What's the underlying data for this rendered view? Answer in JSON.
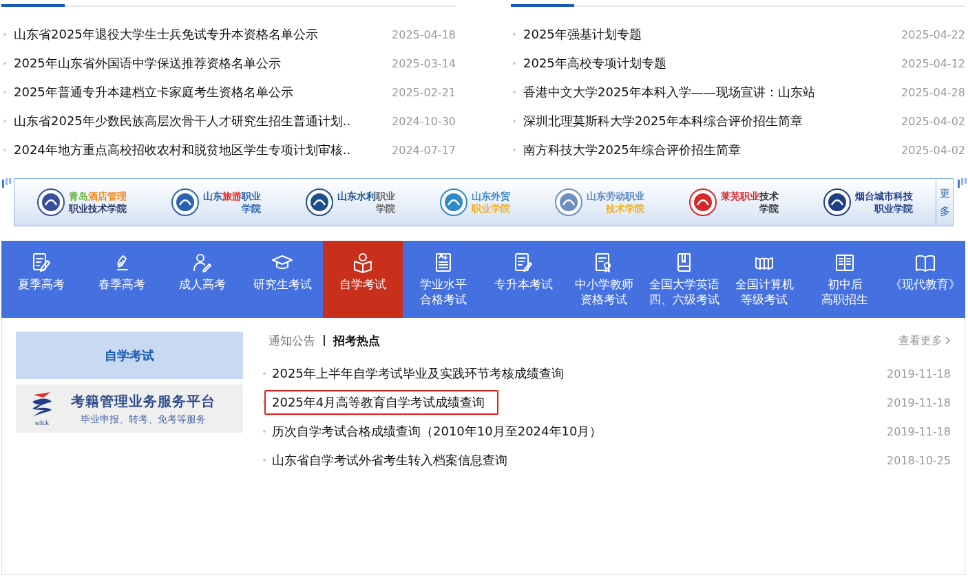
{
  "news_columns": [
    {
      "items": [
        {
          "title": "山东省2025年退役大学生士兵免试专升本资格名单公示",
          "date": "2025-04-18"
        },
        {
          "title": "2025年山东省外国语中学保送推荐资格名单公示",
          "date": "2025-03-14"
        },
        {
          "title": "2025年普通专升本建档立卡家庭考生资格名单公示",
          "date": "2025-02-21"
        },
        {
          "title": "山东省2025年少数民族高层次骨干人才研究生招生普通计划..",
          "date": "2024-10-30"
        },
        {
          "title": "2024年地方重点高校招收农村和脱贫地区学生专项计划审核..",
          "date": "2024-07-17"
        }
      ]
    },
    {
      "items": [
        {
          "title": "2025年强基计划专题",
          "date": "2025-04-22"
        },
        {
          "title": "2025年高校专项计划专题",
          "date": "2025-04-12"
        },
        {
          "title": "香港中文大学2025年本科入学——现场宣讲：山东站",
          "date": "2025-04-28"
        },
        {
          "title": "深圳北理莫斯科大学2025年本科综合评价招生简章",
          "date": "2025-04-02"
        },
        {
          "title": "南方科技大学2025年综合评价招生简章",
          "date": "2025-04-02"
        }
      ]
    }
  ],
  "school_logos": {
    "more": "更多",
    "items": [
      {
        "color": "#3a4f9c",
        "lines": [
          [
            {
              "text": "青岛",
              "color": "#6cb33e"
            },
            {
              "text": "酒店管理",
              "color": "#f08a1c"
            }
          ],
          [
            {
              "text": "职业技术学院",
              "color": "#2a3560"
            }
          ]
        ]
      },
      {
        "color": "#2a63ad",
        "lines": [
          [
            {
              "text": "山东",
              "color": "#2a63ad"
            },
            {
              "text": "旅游",
              "color": "#e0201c"
            },
            {
              "text": "职业",
              "color": "#2a63ad"
            }
          ],
          [
            {
              "text": "学院",
              "color": "#2a63ad"
            }
          ]
        ]
      },
      {
        "color": "#1d4f8c",
        "lines": [
          [
            {
              "text": "山东水利",
              "color": "#1d4f8c"
            },
            {
              "text": "职业",
              "color": "#666666"
            }
          ],
          [
            {
              "text": "学院",
              "color": "#666666"
            }
          ]
        ]
      },
      {
        "color": "#2f8ac8",
        "lines": [
          [
            {
              "text": "山东外贸",
              "color": "#3d8cc6"
            }
          ],
          [
            {
              "text": "职业学院",
              "color": "#f0b020"
            }
          ]
        ]
      },
      {
        "color": "#6b8fc0",
        "lines": [
          [
            {
              "text": "山东劳动职业",
              "color": "#5a86c0"
            }
          ],
          [
            {
              "text": "技术学院",
              "color": "#f0b020"
            }
          ]
        ]
      },
      {
        "color": "#d8282c",
        "lines": [
          [
            {
              "text": "莱芜职业",
              "color": "#d8282c"
            },
            {
              "text": "技术",
              "color": "#333333"
            }
          ],
          [
            {
              "text": "学院",
              "color": "#333333"
            }
          ]
        ]
      },
      {
        "color": "#1f3e86",
        "lines": [
          [
            {
              "text": "烟台城市科技",
              "color": "#1f3e86"
            }
          ],
          [
            {
              "text": "职业学院",
              "color": "#1f3e86"
            }
          ]
        ]
      }
    ]
  },
  "nav": [
    {
      "label": "夏季高考",
      "selected": false
    },
    {
      "label": "春季高考",
      "selected": false
    },
    {
      "label": "成人高考",
      "selected": false
    },
    {
      "label": "研究生考试",
      "selected": false
    },
    {
      "label": "自学考试",
      "selected": true
    },
    {
      "label": [
        "学业水平",
        "合格考试"
      ],
      "selected": false
    },
    {
      "label": "专升本考试",
      "selected": false
    },
    {
      "label": [
        "中小学教师",
        "资格考试"
      ],
      "selected": false
    },
    {
      "label": [
        "全国大学英语",
        "四、六级考试"
      ],
      "selected": false
    },
    {
      "label": [
        "全国计算机",
        "等级考试"
      ],
      "selected": false
    },
    {
      "label": [
        "初中后",
        "高职招生"
      ],
      "selected": false
    },
    {
      "label": "《现代教育》",
      "selected": false
    }
  ],
  "sidebar": {
    "heading": "自学考试",
    "platform": {
      "logo_text": "sdck",
      "title": "考籍管理业务服务平台",
      "subtitle": "毕业申报、转考、免考等服务"
    }
  },
  "content": {
    "tabs": [
      {
        "label": "通知公告",
        "selected": false
      },
      {
        "label": "招考热点",
        "selected": true
      }
    ],
    "more": "查看更多",
    "items": [
      {
        "title": "2025年上半年自学考试毕业及实践环节考核成绩查询",
        "date": "2019-11-18",
        "highlighted": false
      },
      {
        "title": "2025年4月高等教育自学考试成绩查询",
        "date": "2019-11-18",
        "highlighted": true
      },
      {
        "title": "历次自学考试合格成绩查询（2010年10月至2024年10月）",
        "date": "2019-11-18",
        "highlighted": false
      },
      {
        "title": "山东省自学考试外省考生转入档案信息查询",
        "date": "2018-10-25",
        "highlighted": false
      }
    ]
  }
}
